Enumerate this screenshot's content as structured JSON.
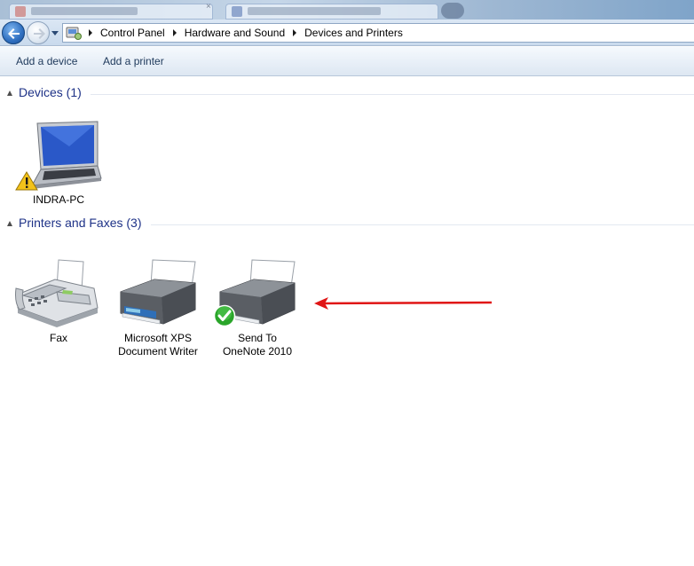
{
  "address_bar": {
    "breadcrumbs": [
      "Control Panel",
      "Hardware and Sound",
      "Devices and Printers"
    ]
  },
  "command_bar": {
    "add_device": "Add a device",
    "add_printer": "Add a printer"
  },
  "groups": {
    "devices": {
      "title": "Devices (1)",
      "items": [
        {
          "label_lines": [
            "INDRA-PC"
          ],
          "icon": "laptop-icon",
          "badge": "warning-icon"
        }
      ]
    },
    "printers": {
      "title": "Printers and Faxes (3)",
      "items": [
        {
          "label_lines": [
            "Fax"
          ],
          "icon": "fax-icon"
        },
        {
          "label_lines": [
            "Microsoft XPS",
            "Document Writer"
          ],
          "icon": "printer-icon"
        },
        {
          "label_lines": [
            "Send To",
            "OneNote 2010"
          ],
          "icon": "printer-icon",
          "badge": "default-check-icon"
        }
      ]
    }
  },
  "colors": {
    "group_title": "#1e3287",
    "command_text": "#1e395b",
    "annotation_arrow": "#e01515",
    "default_badge": "#2aa52a",
    "warning_badge": "#f3c21a"
  }
}
